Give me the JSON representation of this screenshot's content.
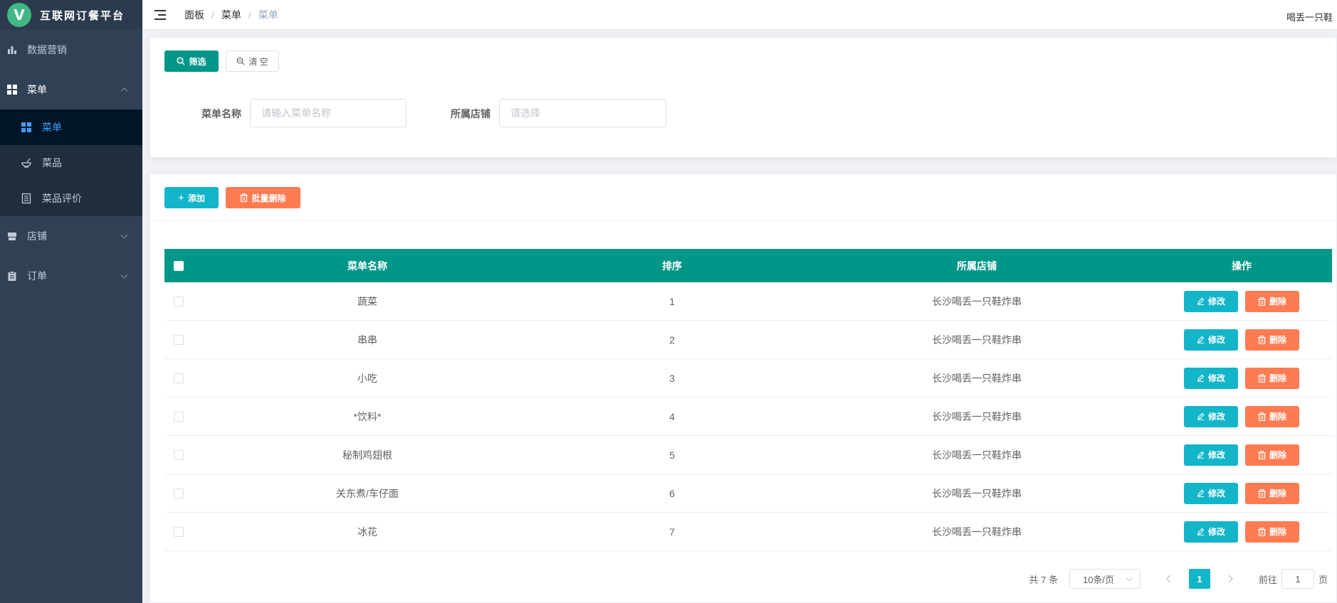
{
  "app": {
    "logo_letter": "V",
    "title": "互联网订餐平台"
  },
  "sidebar": {
    "items": [
      {
        "label": "数据营销",
        "icon": "bar-chart-icon"
      },
      {
        "label": "菜单",
        "icon": "grid-icon",
        "expanded": true,
        "children": [
          {
            "label": "菜单",
            "icon": "grid-icon",
            "active": true
          },
          {
            "label": "菜品",
            "icon": "bowl-icon"
          },
          {
            "label": "菜品评价",
            "icon": "document-icon"
          }
        ]
      },
      {
        "label": "店铺",
        "icon": "store-icon"
      },
      {
        "label": "订单",
        "icon": "clipboard-icon"
      }
    ]
  },
  "header": {
    "breadcrumb": [
      "面板",
      "菜单",
      "菜单"
    ],
    "username": "喝丢一只鞋"
  },
  "filter": {
    "search_label": "筛选",
    "clear_label": "清 空",
    "name_label": "菜单名称",
    "name_placeholder": "请输入菜单名称",
    "shop_label": "所属店铺",
    "shop_placeholder": "请选择"
  },
  "toolbar": {
    "add_label": "添加",
    "batch_delete_label": "批量删除"
  },
  "table": {
    "columns": [
      "菜单名称",
      "排序",
      "所属店铺",
      "操作"
    ],
    "edit_label": "修改",
    "delete_label": "删除",
    "rows": [
      {
        "name": "蔬菜",
        "sort": "1",
        "shop": "长沙喝丢一只鞋炸串"
      },
      {
        "name": "串串",
        "sort": "2",
        "shop": "长沙喝丢一只鞋炸串"
      },
      {
        "name": "小吃",
        "sort": "3",
        "shop": "长沙喝丢一只鞋炸串"
      },
      {
        "name": "*饮料*",
        "sort": "4",
        "shop": "长沙喝丢一只鞋炸串"
      },
      {
        "name": "秘制鸡翅根",
        "sort": "5",
        "shop": "长沙喝丢一只鞋炸串"
      },
      {
        "name": "关东煮/车仔面",
        "sort": "6",
        "shop": "长沙喝丢一只鞋炸串"
      },
      {
        "name": "冰花",
        "sort": "7",
        "shop": "长沙喝丢一只鞋炸串"
      }
    ]
  },
  "pagination": {
    "total": "共 7 条",
    "page_size": "10条/页",
    "current": "1",
    "goto_prefix": "前往",
    "goto_value": "1",
    "goto_suffix": "页"
  },
  "colors": {
    "primary": "#009688",
    "cyan": "#13b5c8",
    "orange": "#ff7b52",
    "sidebar": "#304156"
  }
}
